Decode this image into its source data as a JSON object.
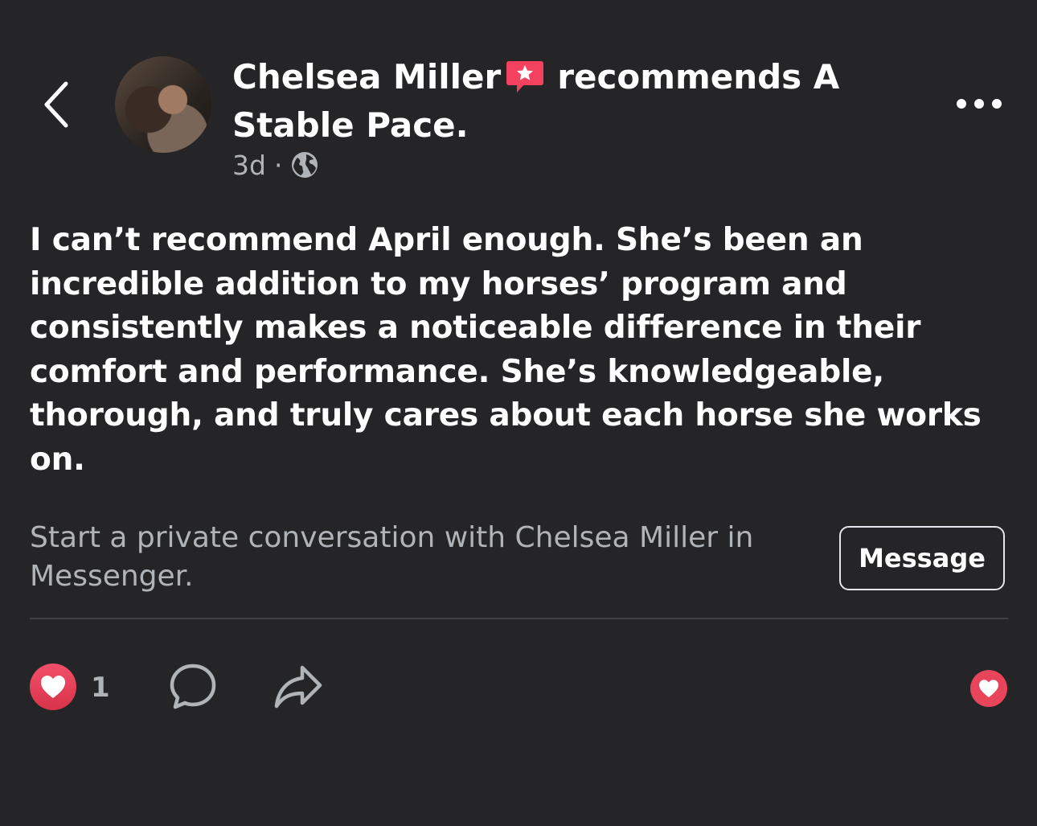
{
  "header": {
    "author_name": "Chelsea Miller",
    "action_text": "recommends A Stable Pace.",
    "timestamp": "3d",
    "separator": "·",
    "privacy_icon": "globe-icon",
    "badge_icon": "star-speech-bubble-icon"
  },
  "post": {
    "body": "I can’t recommend April enough. She’s been an incredible addition to my horses’ program and consistently makes a noticeable difference in their comfort and performance. She’s knowledgeable, thorough, and truly cares about each horse she works on."
  },
  "cta": {
    "text": "Start a private conversation with Chelsea Miller in Messenger.",
    "button_label": "Message"
  },
  "footer": {
    "reaction_count": "1",
    "reaction_icon": "heart-icon",
    "comment_icon": "comment-icon",
    "share_icon": "share-icon"
  },
  "colors": {
    "background": "#252527",
    "text_primary": "#ffffff",
    "text_secondary": "#b0b3b8",
    "heart_red": "#e8445a",
    "badge_pink": "#f3425f"
  }
}
